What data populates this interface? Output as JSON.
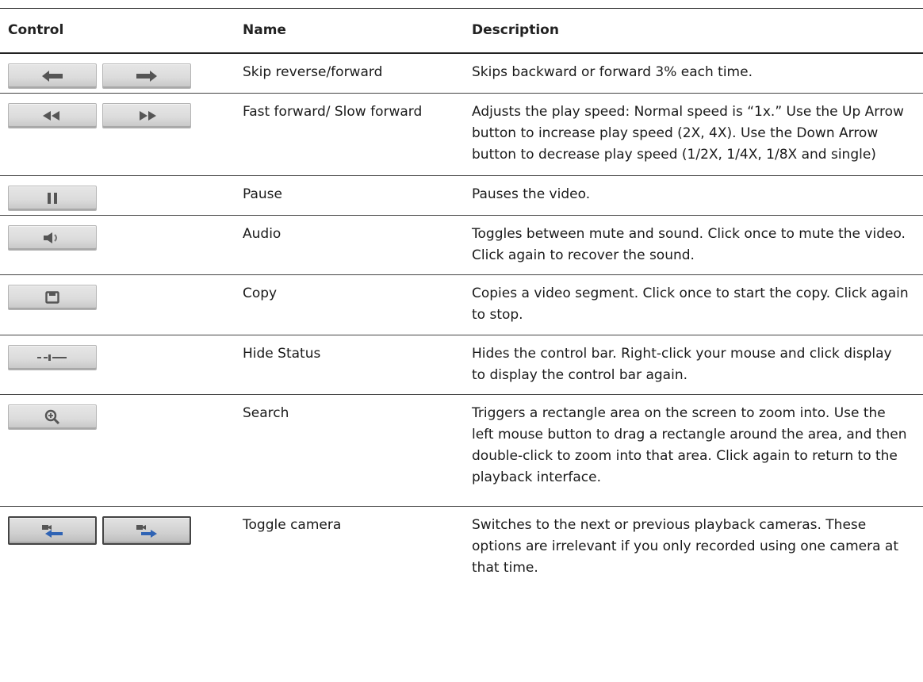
{
  "table": {
    "headers": {
      "control": "Control",
      "name": "Name",
      "description": "Description"
    },
    "rows": [
      {
        "name": "Skip reverse/forward",
        "description": "Skips backward or forward 3% each time.",
        "icons": [
          "skip-reverse-icon",
          "skip-forward-icon"
        ]
      },
      {
        "name": "Fast forward/ Slow forward",
        "description": "Adjusts the play speed: Normal speed is “1x.” Use the Up Arrow button to increase play speed (2X, 4X). Use the Down Arrow button to decrease play speed (1/2X, 1/4X, 1/8X and single)",
        "icons": [
          "slow-forward-icon",
          "fast-forward-icon"
        ]
      },
      {
        "name": "Pause",
        "description": "Pauses the video.",
        "icons": [
          "pause-icon"
        ]
      },
      {
        "name": "Audio",
        "description": "Toggles between mute and sound. Click once to mute the video. Click again to recover the sound.",
        "icons": [
          "speaker-icon"
        ]
      },
      {
        "name": "Copy",
        "description": "Copies a video segment. Click once to start the copy. Click again to stop.",
        "icons": [
          "save-icon"
        ]
      },
      {
        "name": "Hide Status",
        "description": "Hides the control bar. Right-click your mouse and click display to display the control bar again.",
        "icons": [
          "hide-status-icon"
        ]
      },
      {
        "name": "Search",
        "description": "Triggers a rectangle area on the screen to zoom into. Use the left mouse button to drag a rectangle around the area, and then double-click to zoom into that area. Click again to return to the playback interface.",
        "icons": [
          "zoom-icon"
        ]
      },
      {
        "name": "Toggle camera",
        "description": "Switches to the next or previous playback cameras. These options are irrelevant if you only recorded using one camera at that time.",
        "icons": [
          "previous-camera-icon",
          "next-camera-icon"
        ]
      }
    ]
  },
  "colors": {
    "icon_gray": "#555555",
    "icon_blue": "#2f63b4"
  }
}
